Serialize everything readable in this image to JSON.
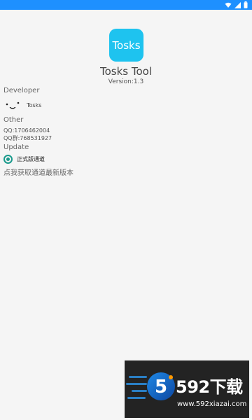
{
  "status_bar": {
    "color": "#1e90ff",
    "icons": [
      "wifi-icon",
      "signal-icon",
      "battery-icon"
    ]
  },
  "app": {
    "icon_text": "Tosks",
    "icon_color": "#1ec3ef",
    "name": "Tosks Tool",
    "version": "Version:1.3"
  },
  "developer": {
    "section_label": "Developer",
    "name": "Tosks"
  },
  "other": {
    "section_label": "Other",
    "qq": "QQ:1706462004",
    "qq_group": "QQ群:768531927"
  },
  "update": {
    "section_label": "Update",
    "channel_option": "正式版通道",
    "channel_selected": true,
    "hint": "点我获取通道最新版本",
    "accent": "#1a9a8c"
  },
  "watermark": {
    "brand": "592下载",
    "url": "www.592xiazai.com",
    "badge_char": "5"
  }
}
